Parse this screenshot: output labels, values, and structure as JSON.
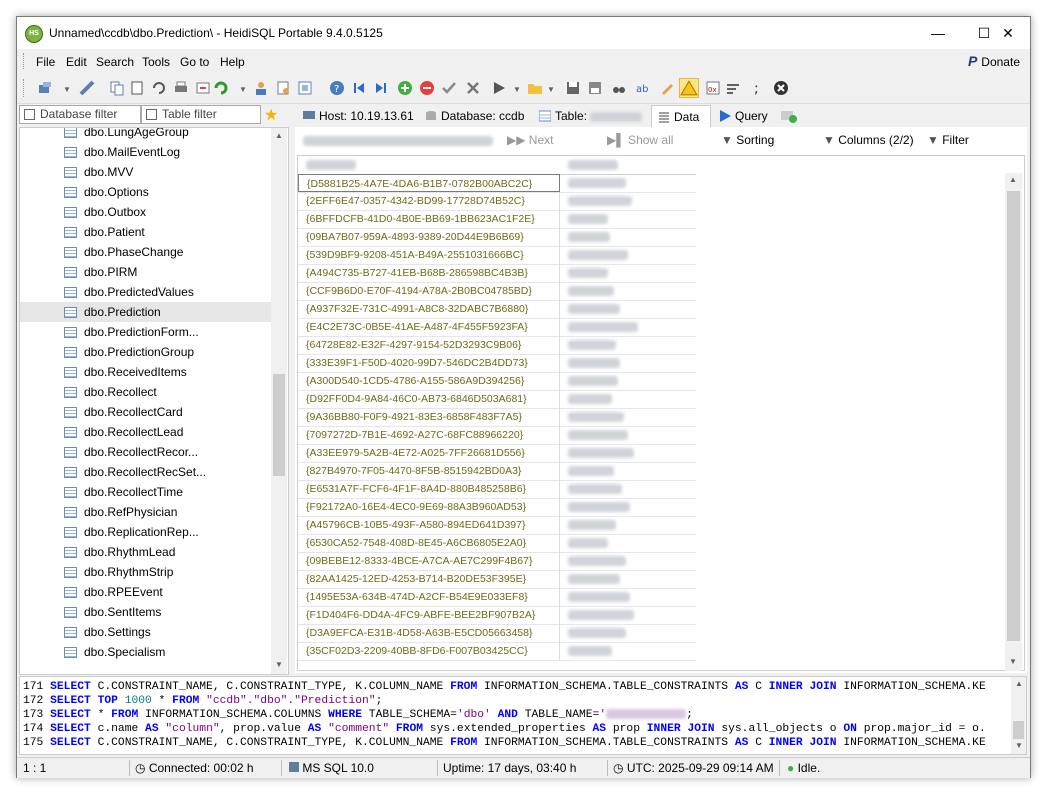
{
  "window": {
    "title": "Unnamed\\ccdb\\dbo.Prediction\\ - HeidiSQL Portable 9.4.0.5125",
    "app_icon_text": "HS"
  },
  "menu": [
    "File",
    "Edit",
    "Search",
    "Tools",
    "Go to",
    "Help"
  ],
  "donate_label": "Donate",
  "filters": {
    "database": "Database filter",
    "table": "Table filter"
  },
  "tabs": {
    "host": "Host: 10.19.13.61",
    "database": "Database: ccdb",
    "table": "Table:",
    "data": "Data",
    "query": "Query"
  },
  "tree_items": [
    "dbo.LungAgeGroup",
    "dbo.MailEventLog",
    "dbo.MVV",
    "dbo.Options",
    "dbo.Outbox",
    "dbo.Patient",
    "dbo.PhaseChange",
    "dbo.PIRM",
    "dbo.PredictedValues",
    "dbo.Prediction",
    "dbo.PredictionForm...",
    "dbo.PredictionGroup",
    "dbo.ReceivedItems",
    "dbo.Recollect",
    "dbo.RecollectCard",
    "dbo.RecollectLead",
    "dbo.RecollectRecor...",
    "dbo.RecollectRecSet...",
    "dbo.RecollectTime",
    "dbo.RefPhysician",
    "dbo.ReplicationRep...",
    "dbo.RhythmLead",
    "dbo.RhythmStrip",
    "dbo.RPEEvent",
    "dbo.SentItems",
    "dbo.Settings",
    "dbo.Specialism"
  ],
  "selected_tree_item": "dbo.Prediction",
  "grid_toolbar": {
    "next": "Next",
    "show_all": "Show all",
    "sorting": "Sorting",
    "columns": "Columns (2/2)",
    "filter": "Filter"
  },
  "grid_rows": [
    "{D5881B25-4A7E-4DA6-B1B7-0782B00ABC2C}",
    "{2EFF6E47-0357-4342-BD99-17728D74B52C}",
    "{6BFFDCFB-41D0-4B0E-BB69-1BB623AC1F2E}",
    "{09BA7B07-959A-4893-9389-20D44E9B6B69}",
    "{539D9BF9-9208-451A-B49A-2551031666BC}",
    "{A494C735-B727-41EB-B68B-286598BC4B3B}",
    "{CCF9B6D0-E70F-4194-A78A-2B0BC04785BD}",
    "{A937F32E-731C-4991-A8C8-32DABC7B6880}",
    "{E4C2E73C-0B5E-41AE-A487-4F455F5923FA}",
    "{64728E82-E32F-4297-9154-52D3293C9B06}",
    "{333E39F1-F50D-4020-99D7-546DC2B4DD73}",
    "{A300D540-1CD5-4786-A155-586A9D394256}",
    "{D92FF0D4-9A84-46C0-AB73-6846D503A681}",
    "{9A36BB80-F0F9-4921-83E3-6858F483F7A5}",
    "{7097272D-7B1E-4692-A27C-68FC88966220}",
    "{A33EE979-5A2B-4E72-A025-7FF26681D556}",
    "{827B4970-7F05-4470-8F5B-8515942BD0A3}",
    "{E6531A7F-FCF6-4F1F-8A4D-880B485258B6}",
    "{F92172A0-16E4-4EC0-9E69-88A3B960AD53}",
    "{A45796CB-10B5-493F-A580-894ED641D397}",
    "{6530CA52-7548-408D-8E45-A6CB6805E2A0}",
    "{09BEBE12-8333-4BCE-A7CA-AE7C299F4B67}",
    "{82AA1425-12ED-4253-B714-B20DE53F395E}",
    "{1495E53A-634B-474D-A2CF-B54E9E033EF8}",
    "{F1D404F6-DD4A-4FC9-ABFE-BEE2BF907B2A}",
    "{D3A9EFCA-E31B-4D58-A63B-E5CD05663458}",
    "{35CF02D3-2209-40BB-8FD6-F007B03425CC}"
  ],
  "log": {
    "line171_num": "171",
    "line172_num": "172",
    "line173_num": "173",
    "line174_num": "174",
    "line175_num": "175",
    "l171": [
      "SELECT",
      " C.CONSTRAINT_NAME, C.CONSTRAINT_TYPE, K.COLUMN_NAME ",
      "FROM",
      " INFORMATION_SCHEMA.TABLE_CONSTRAINTS ",
      "AS",
      " C ",
      "INNER JOIN",
      " INFORMATION_SCHEMA.KE"
    ],
    "l172": [
      "SELECT TOP ",
      "1000",
      " * ",
      "FROM",
      " ",
      "\"ccdb\".\"dbo\".\"Prediction\"",
      ";"
    ],
    "l173": [
      "SELECT",
      " * ",
      "FROM",
      " INFORMATION_SCHEMA.COLUMNS ",
      "WHERE",
      " TABLE_SCHEMA=",
      "'dbo'",
      " ",
      "AND",
      " TABLE_NAME=",
      "'",
      ";"
    ],
    "l174": [
      "SELECT",
      " c.name ",
      "AS",
      " ",
      "\"column\"",
      ", prop.value ",
      "AS",
      " ",
      "\"comment\"",
      " ",
      "FROM",
      " sys.extended_properties ",
      "AS",
      " prop ",
      "INNER JOIN",
      " sys.all_objects o ",
      "ON",
      " prop.major_id = o."
    ],
    "l175": [
      "SELECT",
      " C.CONSTRAINT_NAME, C.CONSTRAINT_TYPE, K.COLUMN_NAME ",
      "FROM",
      " INFORMATION_SCHEMA.TABLE_CONSTRAINTS ",
      "AS",
      " C ",
      "INNER JOIN",
      " INFORMATION_SCHEMA.KE"
    ]
  },
  "status": {
    "position": "1 : 1",
    "connected": "Connected: 00:02 h",
    "server": "MS SQL 10.0",
    "uptime": "Uptime: 17 days, 03:40 h",
    "utc": "UTC: 2025-09-29 09:14 AM",
    "state": "Idle."
  },
  "colors": {
    "keyword": "#0000ff",
    "string": "#800080",
    "number": "#008080",
    "guid": "#6b6b1a"
  }
}
